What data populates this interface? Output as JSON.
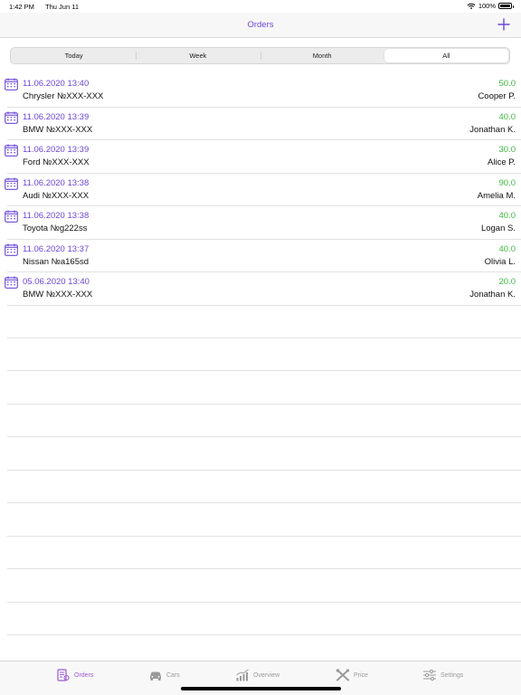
{
  "status_bar": {
    "time": "1:42 PM",
    "date": "Thu Jun 11",
    "battery": "100%"
  },
  "nav": {
    "title": "Orders",
    "add_icon": "plus-icon"
  },
  "colors": {
    "accent": "#6b47d6",
    "price": "#3dba3d",
    "tab_active": "#9b59d0",
    "tab_inactive": "#9a9a9a"
  },
  "filter": {
    "segments": [
      "Today",
      "Week",
      "Month",
      "All"
    ],
    "selected": "All"
  },
  "orders": [
    {
      "date": "11.06.2020 13:40",
      "car": "Chrysler №XXX-XXX",
      "price": "50.0",
      "customer": "Cooper P."
    },
    {
      "date": "11.06.2020 13:39",
      "car": "BMW №XXX-XXX",
      "price": "40.0",
      "customer": "Jonathan K."
    },
    {
      "date": "11.06.2020 13:39",
      "car": "Ford №XXX-XXX",
      "price": "30.0",
      "customer": "Alice P."
    },
    {
      "date": "11.06.2020 13:38",
      "car": "Audi №XXX-XXX",
      "price": "90.0",
      "customer": "Amelia M."
    },
    {
      "date": "11.06.2020 13:38",
      "car": "Toyota №g222ss",
      "price": "40.0",
      "customer": "Logan S."
    },
    {
      "date": "11.06.2020 13:37",
      "car": "Nissan №a165sd",
      "price": "40.0",
      "customer": "Olivia L."
    },
    {
      "date": "05.06.2020 13:40",
      "car": "BMW №XXX-XXX",
      "price": "20.0",
      "customer": "Jonathan K."
    }
  ],
  "tabs": [
    {
      "label": "Orders",
      "icon": "orders-icon",
      "active": true
    },
    {
      "label": "Cars",
      "icon": "car-icon",
      "active": false
    },
    {
      "label": "Overview",
      "icon": "chart-icon",
      "active": false
    },
    {
      "label": "Price",
      "icon": "tools-icon",
      "active": false
    },
    {
      "label": "Settings",
      "icon": "sliders-icon",
      "active": false
    }
  ]
}
